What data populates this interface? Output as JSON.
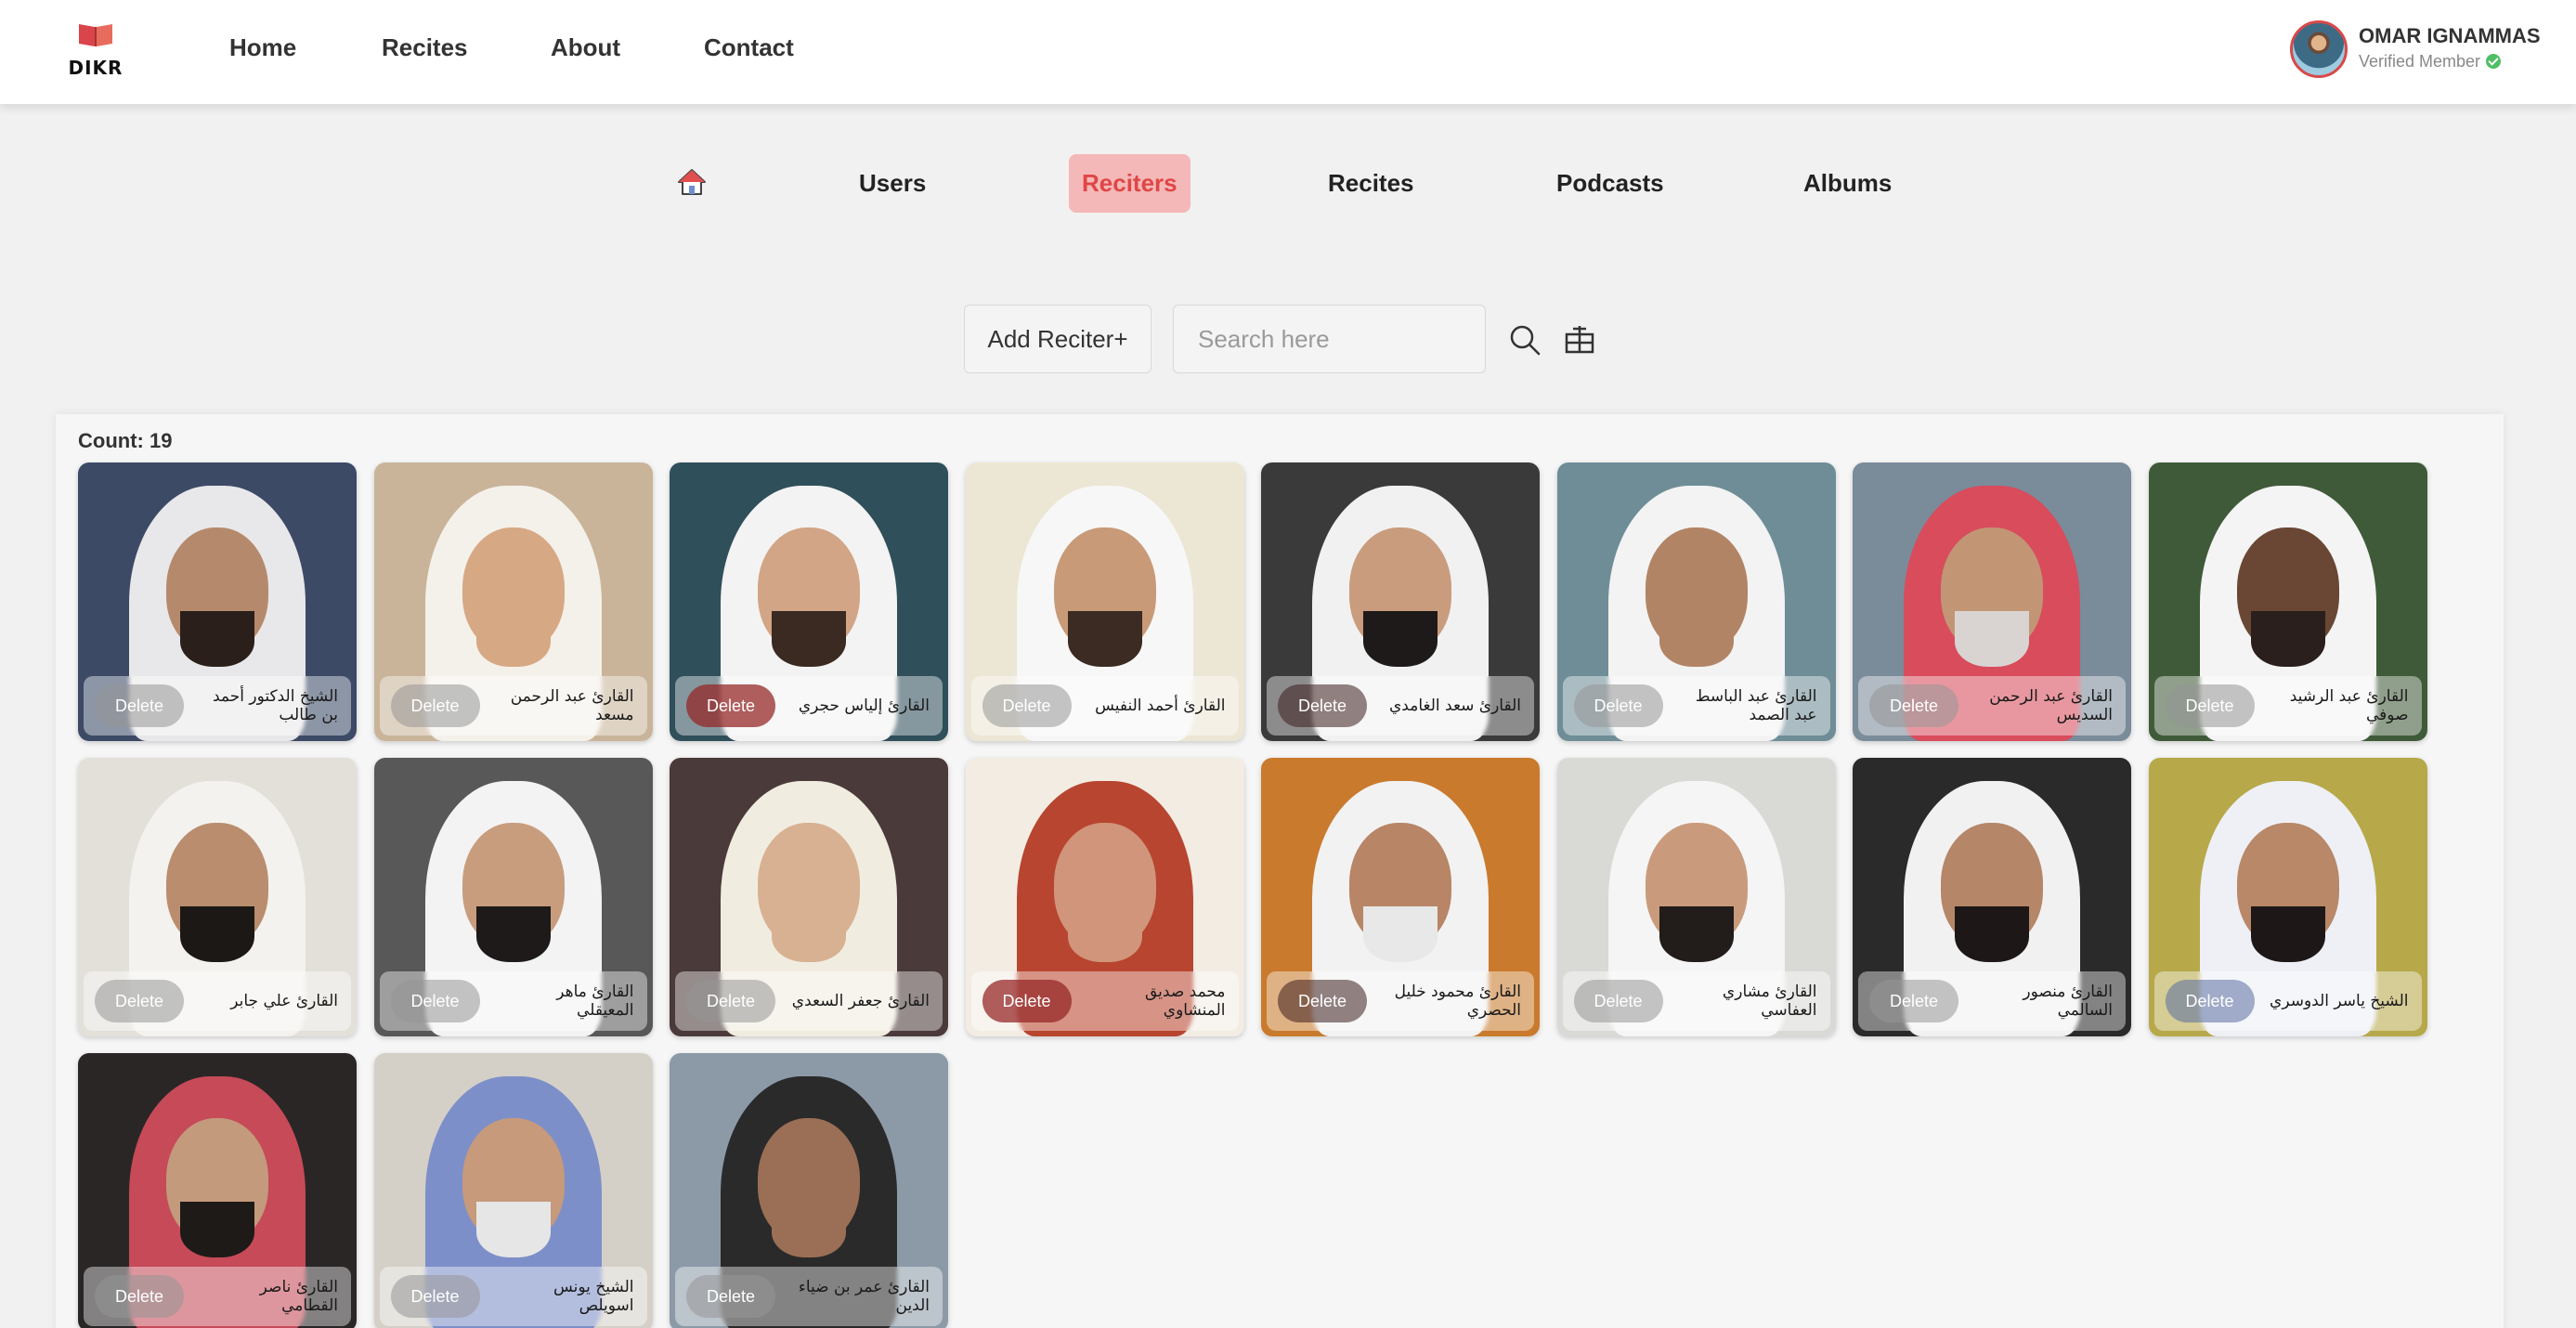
{
  "brand": {
    "name": "DIKR"
  },
  "nav": {
    "home": "Home",
    "recites": "Recites",
    "about": "About",
    "contact": "Contact"
  },
  "profile": {
    "name": "OMAR IGNAMMAS",
    "status": "Verified Member"
  },
  "tabs": {
    "users": "Users",
    "reciters": "Reciters",
    "recites": "Recites",
    "podcasts": "Podcasts",
    "albums": "Albums",
    "active": "Reciters"
  },
  "toolbar": {
    "add_label": "Add Reciter+",
    "search_placeholder": "Search here"
  },
  "count_label": "Count: 19",
  "delete_label": "Delete",
  "colors": {
    "accent": "#e04646",
    "accent_bg": "#f5b8b8",
    "verified": "#4fbf65"
  },
  "reciters": [
    {
      "name": "الشيخ الدكتور أحمد بن طالب",
      "bg": "#3c4a66",
      "skin": "#b58a6c",
      "cloth": "#e8e8ea",
      "beard": "#2a1f1a",
      "btn": ""
    },
    {
      "name": "القارئ عبد الرحمن مسعد",
      "bg": "#c9b49a",
      "skin": "#d7a884",
      "cloth": "#f4f1ea",
      "beard": "#d7a884",
      "btn": ""
    },
    {
      "name": "القارئ إلياس حجري",
      "bg": "#2f4f5a",
      "skin": "#d1a585",
      "cloth": "#f3f3f3",
      "beard": "#3a2a22",
      "btn": "red"
    },
    {
      "name": "القارئ أحمد النفيس",
      "bg": "#ece6d4",
      "skin": "#c89a78",
      "cloth": "#f7f7f7",
      "beard": "#3b2b22",
      "btn": ""
    },
    {
      "name": "القارئ سعد الغامدي",
      "bg": "#3b3a3a",
      "skin": "#c99c7e",
      "cloth": "#f1f1f1",
      "beard": "#1e1a19",
      "btn": "dark"
    },
    {
      "name": "القارئ عبد الباسط عبد الصمد",
      "bg": "#6e8d97",
      "skin": "#b28466",
      "cloth": "#f3f3f3",
      "beard": "#b28466",
      "btn": ""
    },
    {
      "name": "القارئ عبد الرحمن السديس",
      "bg": "#7a8b9a",
      "skin": "#c29674",
      "cloth": "#d84c5c",
      "beard": "#d9d4d2",
      "btn": ""
    },
    {
      "name": "القارئ عبد الرشيد صوفي",
      "bg": "#3f5a38",
      "skin": "#6a4634",
      "cloth": "#f4f4f4",
      "beard": "#2a1f1c",
      "btn": ""
    },
    {
      "name": "القارئ علي جابر",
      "bg": "#e3e0d9",
      "skin": "#b98d6e",
      "cloth": "#f3f2ee",
      "beard": "#1c1816",
      "btn": ""
    },
    {
      "name": "القارئ ماهر المعيقلي",
      "bg": "#585858",
      "skin": "#c89d7e",
      "cloth": "#f3f3f3",
      "beard": "#1d1a19",
      "btn": ""
    },
    {
      "name": "القارئ جعفر السعدي",
      "bg": "#4a3a3a",
      "skin": "#d7b191",
      "cloth": "#f1ece0",
      "beard": "#d7b191",
      "btn": ""
    },
    {
      "name": "محمد صديق المنشاوي",
      "bg": "#f3ece3",
      "skin": "#d0957a",
      "cloth": "#b8452f",
      "beard": "#d0957a",
      "btn": "red"
    },
    {
      "name": "القارئ محمود خليل الحصري",
      "bg": "#c97a2d",
      "skin": "#b88566",
      "cloth": "#f2f2f2",
      "beard": "#e8e8e8",
      "btn": "dark"
    },
    {
      "name": "القارئ مشاري العفاسي",
      "bg": "#d9dad6",
      "skin": "#c99b7c",
      "cloth": "#f5f5f5",
      "beard": "#221c1a",
      "btn": ""
    },
    {
      "name": "القارئ منصور السالمي",
      "bg": "#2a2a2a",
      "skin": "#b58668",
      "cloth": "#f1f1f1",
      "beard": "#1d1817",
      "btn": ""
    },
    {
      "name": "الشيخ ياسر الدوسري",
      "bg": "#b7a84a",
      "skin": "#b88868",
      "cloth": "#eef0f6",
      "beard": "#1d1817",
      "btn": "blue"
    },
    {
      "name": "القارئ ناصر القطامي",
      "bg": "#2a2626",
      "skin": "#c49a7c",
      "cloth": "#c64a58",
      "beard": "#1e1a18",
      "btn": ""
    },
    {
      "name": "الشيخ يونس اسويلص",
      "bg": "#d4d0c8",
      "skin": "#c69a7b",
      "cloth": "#7d8fc8",
      "beard": "#e6e6e6",
      "btn": ""
    },
    {
      "name": "القارئ عمر بن ضياء الدين",
      "bg": "#8c9aa8",
      "skin": "#9b6f55",
      "cloth": "#2a2a2a",
      "beard": "#9b6f55",
      "btn": ""
    }
  ]
}
